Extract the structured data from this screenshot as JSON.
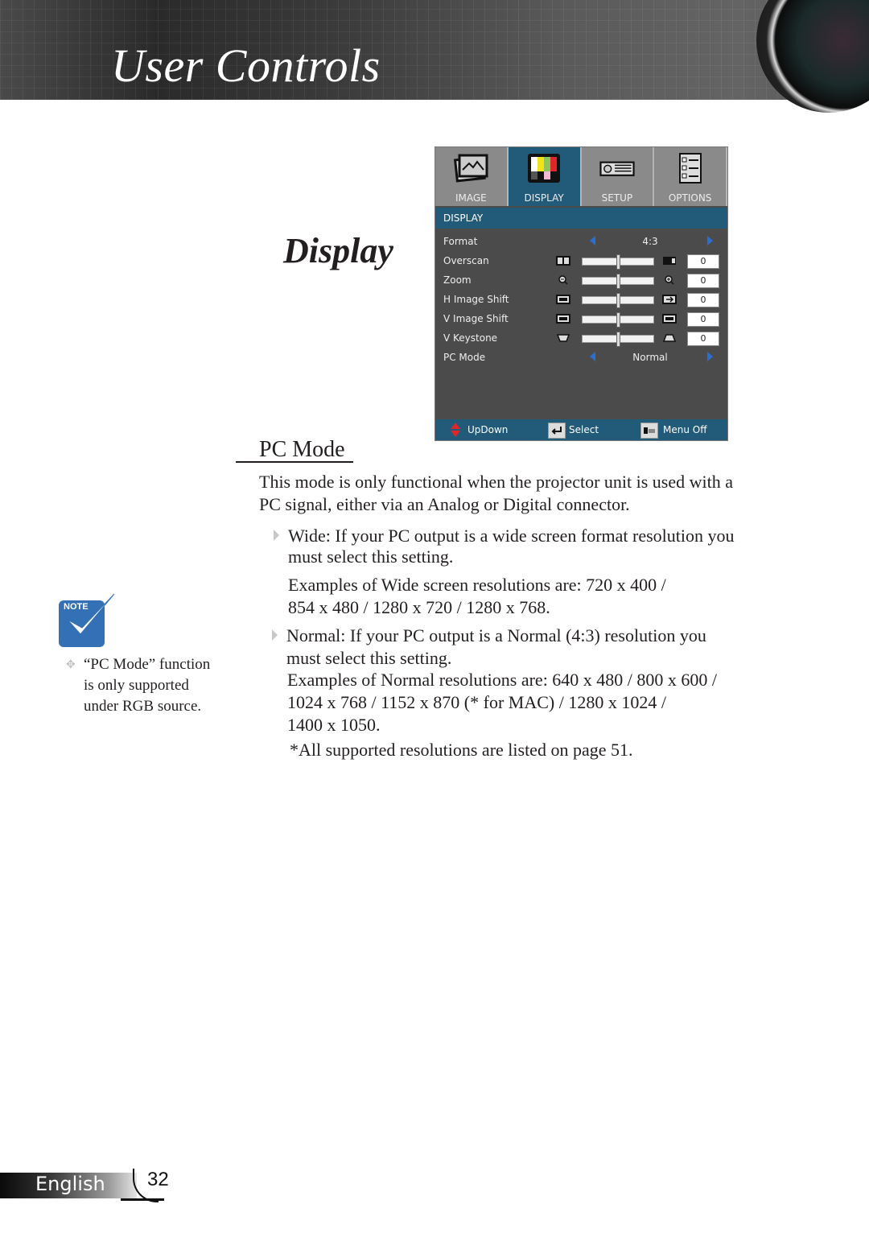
{
  "header": {
    "title": "User Controls"
  },
  "section_title": "Display",
  "osd": {
    "tabs": [
      {
        "label": "IMAGE",
        "icon": "image-icon",
        "active": false
      },
      {
        "label": "DISPLAY",
        "icon": "color-bars-icon",
        "active": true
      },
      {
        "label": "SETUP",
        "icon": "projector-icon",
        "active": false
      },
      {
        "label": "OPTIONS",
        "icon": "checklist-icon",
        "active": false
      }
    ],
    "submenu_title": "DISPLAY",
    "rows": {
      "format": {
        "label": "Format",
        "value": "4:3"
      },
      "overscan": {
        "label": "Overscan",
        "value": "0",
        "slider_fraction": 0.5
      },
      "zoom": {
        "label": "Zoom",
        "value": "0",
        "slider_fraction": 0.5
      },
      "h_image_shift": {
        "label": "H Image Shift",
        "value": "0",
        "slider_fraction": 0.5
      },
      "v_image_shift": {
        "label": "V Image Shift",
        "value": "0",
        "slider_fraction": 0.5
      },
      "v_keystone": {
        "label": "V Keystone",
        "value": "0",
        "slider_fraction": 0.5
      },
      "pc_mode": {
        "label": "PC Mode",
        "value": "Normal"
      }
    },
    "footer": {
      "updown": "UpDown",
      "select": "Select",
      "menu_off": "Menu Off"
    }
  },
  "content": {
    "heading": "PC Mode",
    "intro_line1": "This mode is only functional when the projector unit is used with a",
    "intro_line2": "PC signal, either via an Analog or Digital connector.",
    "wide_line1": "Wide: If your PC output is a wide screen format resolution you",
    "wide_line2": "must select this setting.",
    "wide_ex_line1": "Examples of Wide screen resolutions are: 720 x 400 /",
    "wide_ex_line2": "854 x 480 / 1280 x 720 / 1280 x 768.",
    "normal_line1": "Normal: If your PC output is a Normal (4:3) resolution you",
    "normal_line2": "must select this setting.",
    "normal_ex_line1": "Examples of Normal resolutions are: 640 x 480 / 800 x 600 /",
    "normal_ex_line2": "1024 x 768 / 1152 x 870 (* for MAC) / 1280 x 1024 /",
    "normal_ex_line3": "1400 x 1050.",
    "footnote": "*All supported resolutions are listed on page 51."
  },
  "note": {
    "badge": "NOTE",
    "line1": "“PC Mode” function",
    "line2": "is only supported",
    "line3": "under RGB source."
  },
  "footer": {
    "language": "English",
    "page_number": "32"
  }
}
